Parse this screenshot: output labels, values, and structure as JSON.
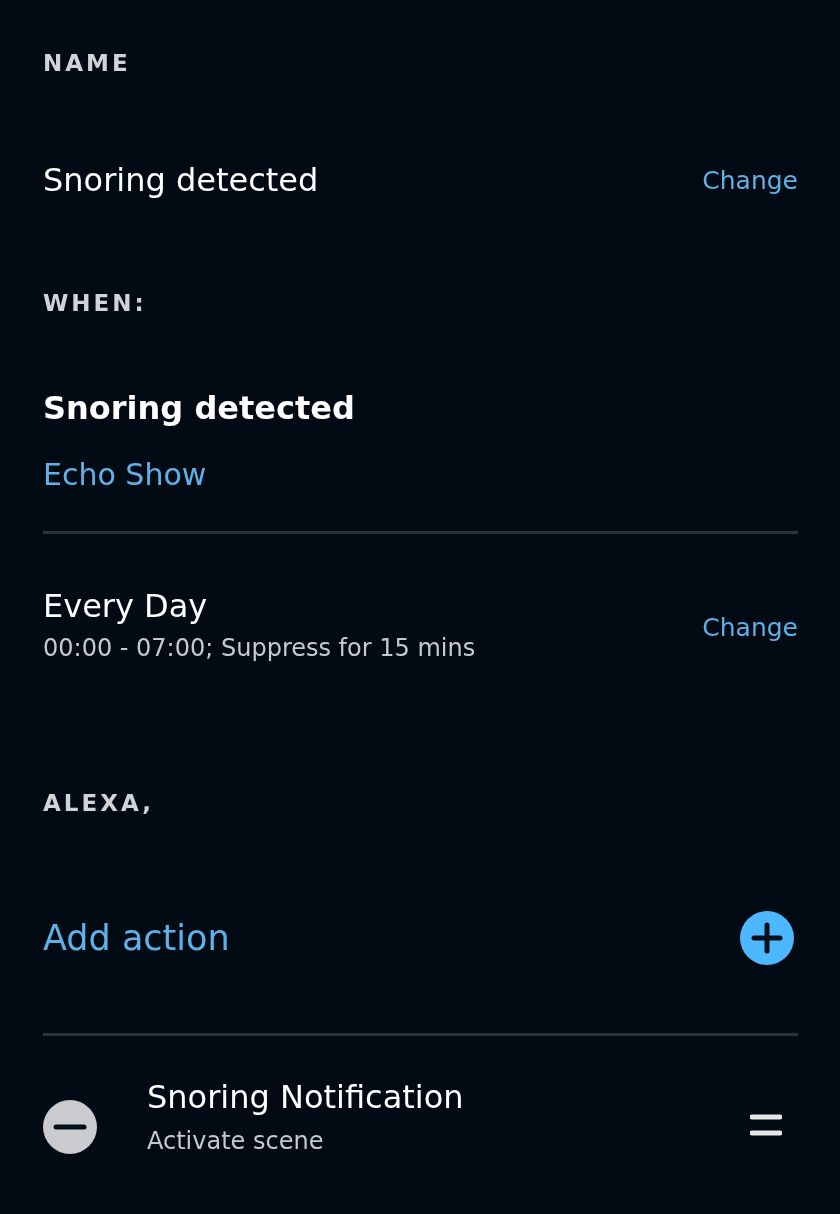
{
  "name_section": {
    "heading": "NAME",
    "value": "Snoring detected",
    "change_link": "Change"
  },
  "when_section": {
    "heading": "WHEN:",
    "trigger": "Snoring detected",
    "device": "Echo Show",
    "schedule": "Every Day",
    "schedule_detail": "00:00 - 07:00; Suppress for 15 mins",
    "change_link": "Change"
  },
  "actions_section": {
    "heading": "ALEXA,",
    "add_action": "Add action",
    "actions": [
      {
        "title": "Snoring Notification",
        "subtitle": "Activate scene"
      }
    ]
  }
}
